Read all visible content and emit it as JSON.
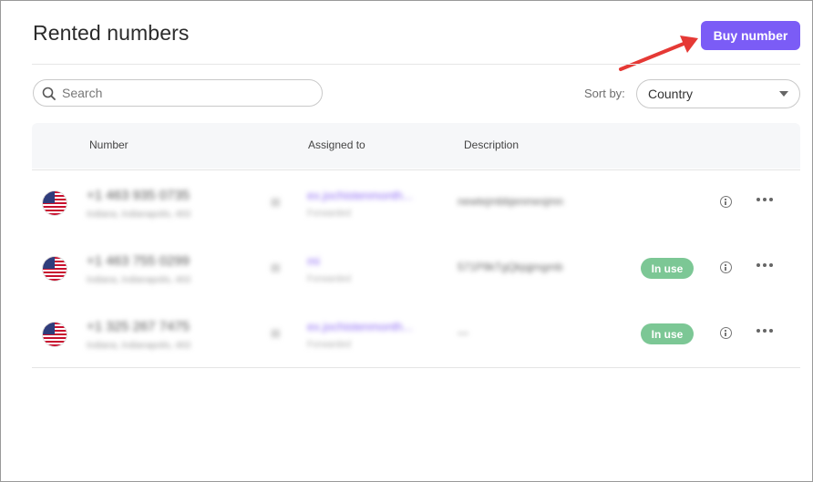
{
  "header": {
    "title": "Rented numbers",
    "buy_button": "Buy number"
  },
  "filters": {
    "search_placeholder": "Search",
    "sort_label": "Sort by:",
    "sort_value": "Country"
  },
  "table": {
    "columns": [
      "Number",
      "Assigned to",
      "Description"
    ],
    "rows": [
      {
        "flag": "us-flag-icon",
        "number": "+1 463 935 0735",
        "location": "Indiana, Indianapolis, 463",
        "assigned": "ex.jochistenmonth...",
        "assigned_sub": "Forwarded",
        "description": "newtejmbbjenmesjmn",
        "status": ""
      },
      {
        "flag": "us-flag-icon",
        "number": "+1 463 755 0299",
        "location": "Indiana, Indianapolis, 463",
        "assigned": "mi",
        "assigned_sub": "Forwarded",
        "description": "571P9kTgQkjqjmgmb",
        "status": "In use"
      },
      {
        "flag": "us-flag-icon",
        "number": "+1 325 267 7475",
        "location": "Indiana, Indianapolis, 463",
        "assigned": "ex.jochistenmonth...",
        "assigned_sub": "Forwarded",
        "description": "—",
        "status": "In use"
      }
    ]
  },
  "colors": {
    "accent": "#7b5cf6",
    "badge_green": "#7cc795",
    "annotation_arrow": "#e53935"
  }
}
